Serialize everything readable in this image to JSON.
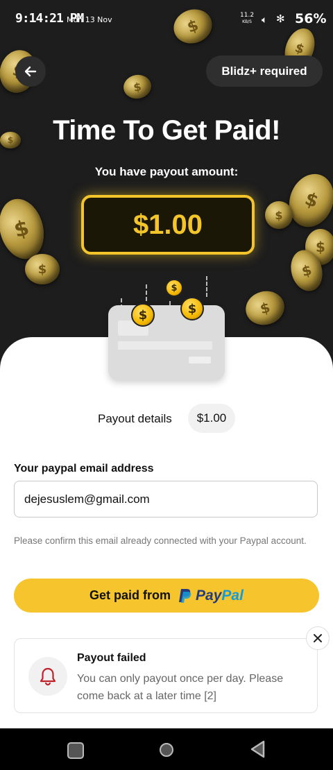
{
  "status_bar": {
    "time": "9:14:21 PM",
    "date": "Mon 13 Nov",
    "net_speed_value": "11.2",
    "net_speed_unit": "KB/S",
    "battery": "56%"
  },
  "header": {
    "back_icon": "arrow-left-icon",
    "badge_label": "Blidz+ required"
  },
  "hero": {
    "title": "Time To Get Paid!",
    "subtitle": "You have payout amount:",
    "amount": "$1.00"
  },
  "payout": {
    "details_label": "Payout details",
    "details_value": "$1.00"
  },
  "form": {
    "email_label": "Your paypal email address",
    "email_value": "dejesuslem@gmail.com",
    "note": "Please confirm this email already connected with your Paypal account.",
    "button_label": "Get paid from",
    "paypal_text_1": "Pay",
    "paypal_text_2": "Pal"
  },
  "toast": {
    "title": "Payout failed",
    "message": "You can only payout once per day. Please come back at a later time [2]",
    "icon": "bell-icon",
    "close_icon": "close-icon"
  },
  "colors": {
    "accent": "#f6c42c",
    "amount_border": "#f3c52a",
    "dark_bg": "#1d1d1d",
    "bell": "#c0222b"
  }
}
